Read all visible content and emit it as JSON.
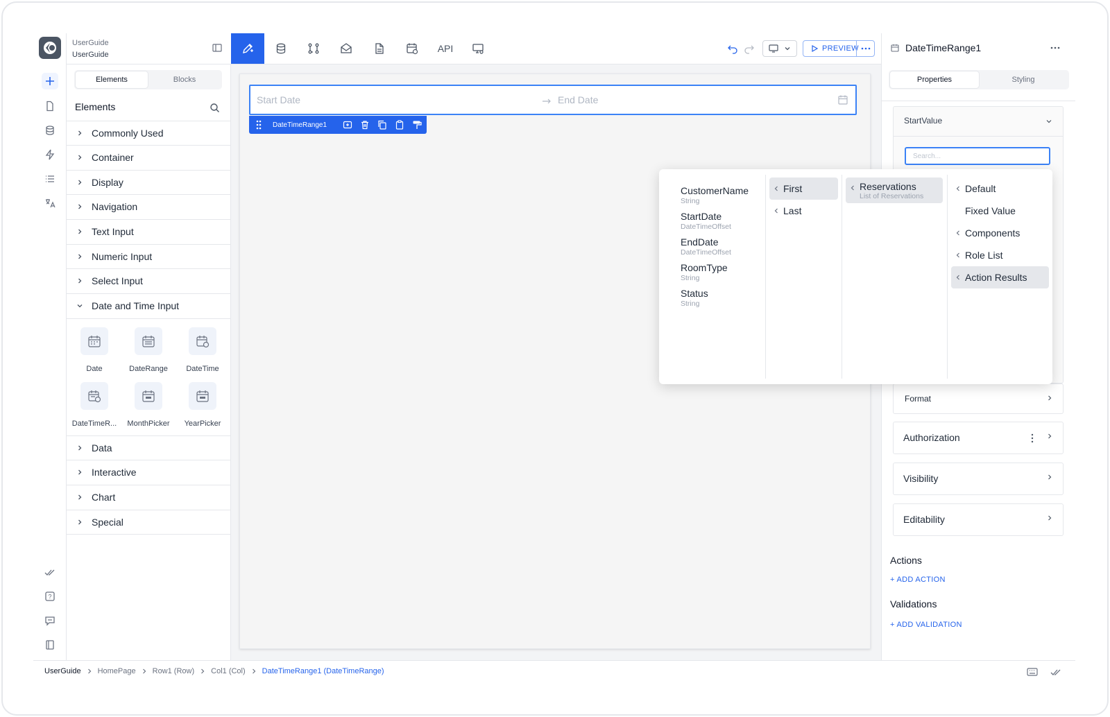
{
  "project": {
    "name": "UserGuide",
    "subtitle": "UserGuide"
  },
  "toolbar": {
    "api_label": "API",
    "preview_label": "PREVIEW"
  },
  "left_panel": {
    "tabs": [
      "Elements",
      "Blocks"
    ],
    "heading": "Elements",
    "categories_top": [
      "Commonly Used",
      "Container",
      "Display",
      "Navigation",
      "Text Input",
      "Numeric Input",
      "Select Input",
      "Date and Time Input"
    ],
    "components": [
      "Date",
      "DateRange",
      "DateTime",
      "DateTimeR...",
      "MonthPicker",
      "YearPicker"
    ],
    "categories_bottom": [
      "Data",
      "Interactive",
      "Chart",
      "Special"
    ]
  },
  "canvas": {
    "start_placeholder": "Start Date",
    "end_placeholder": "End Date",
    "selected_component": "DateTimeRange1"
  },
  "right_panel": {
    "title": "DateTimeRange1",
    "tabs": [
      "Properties",
      "Styling"
    ],
    "start_value_label": "StartValue",
    "search_placeholder": "Search...",
    "format_label": "Format",
    "authorization_label": "Authorization",
    "visibility_label": "Visibility",
    "editability_label": "Editability",
    "actions_heading": "Actions",
    "add_action": "+ ADD ACTION",
    "validations_heading": "Validations",
    "add_validation": "+ ADD VALIDATION"
  },
  "popover": {
    "fields": [
      {
        "name": "CustomerName",
        "type": "String"
      },
      {
        "name": "StartDate",
        "type": "DateTimeOffset"
      },
      {
        "name": "EndDate",
        "type": "DateTimeOffset"
      },
      {
        "name": "RoomType",
        "type": "String"
      },
      {
        "name": "Status",
        "type": "String"
      }
    ],
    "positions": [
      "First",
      "Last"
    ],
    "source": {
      "name": "Reservations",
      "type": "List of Reservations"
    },
    "sources": [
      "Default",
      "Fixed Value",
      "Components",
      "Role List",
      "Action Results"
    ]
  },
  "breadcrumb": [
    "UserGuide",
    "HomePage",
    "Row1 (Row)",
    "Col1 (Col)",
    "DateTimeRange1 (DateTimeRange)"
  ],
  "colors": {
    "accent": "#2563eb",
    "border": "#e5e7eb",
    "canvas": "#f3f4f6"
  }
}
